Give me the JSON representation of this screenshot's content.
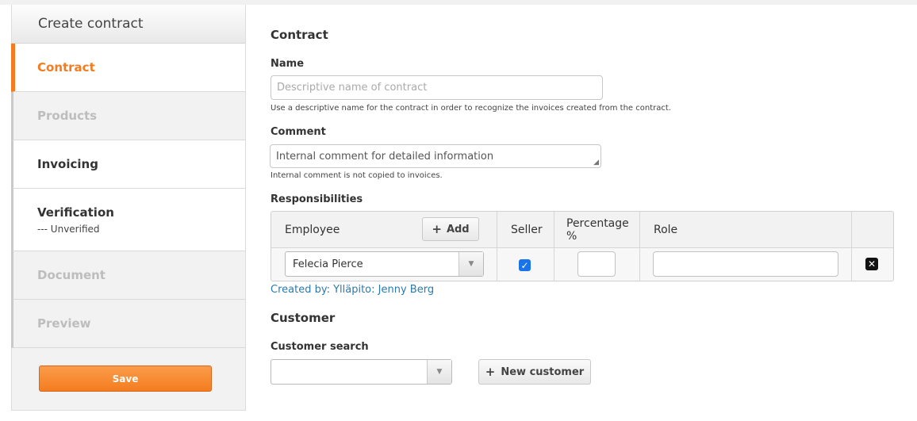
{
  "sidebar": {
    "title": "Create contract",
    "items": [
      {
        "label": "Contract",
        "sub": ""
      },
      {
        "label": "Products",
        "sub": ""
      },
      {
        "label": "Invoicing",
        "sub": ""
      },
      {
        "label": "Verification",
        "sub": "--- Unverified"
      },
      {
        "label": "Document",
        "sub": ""
      },
      {
        "label": "Preview",
        "sub": ""
      }
    ],
    "save_label": "Save"
  },
  "contract": {
    "section_title": "Contract",
    "name_label": "Name",
    "name_placeholder": "Descriptive name of contract",
    "name_help": "Use a descriptive name for the contract in order to recognize the invoices created from the contract.",
    "comment_label": "Comment",
    "comment_placeholder": "Internal comment for detailed information",
    "comment_help": "Internal comment is not copied to invoices."
  },
  "responsibilities": {
    "title": "Responsibilities",
    "headers": {
      "employee": "Employee",
      "add": "Add",
      "seller": "Seller",
      "percentage": "Percentage %",
      "role": "Role"
    },
    "rows": [
      {
        "employee": "Felecia Pierce",
        "seller": true,
        "percentage": "",
        "role": ""
      }
    ],
    "created_by": "Created by: Ylläpito: Jenny Berg"
  },
  "customer": {
    "section_title": "Customer",
    "search_label": "Customer search",
    "search_value": "",
    "new_customer_label": "New customer"
  },
  "icons": {
    "plus": "plus-icon",
    "dropdown": "chevron-down-icon",
    "check": "check-icon",
    "delete": "close-icon"
  },
  "colors": {
    "accent": "#f47c20",
    "link": "#2a7ab0",
    "checkbox": "#1a73e8"
  }
}
